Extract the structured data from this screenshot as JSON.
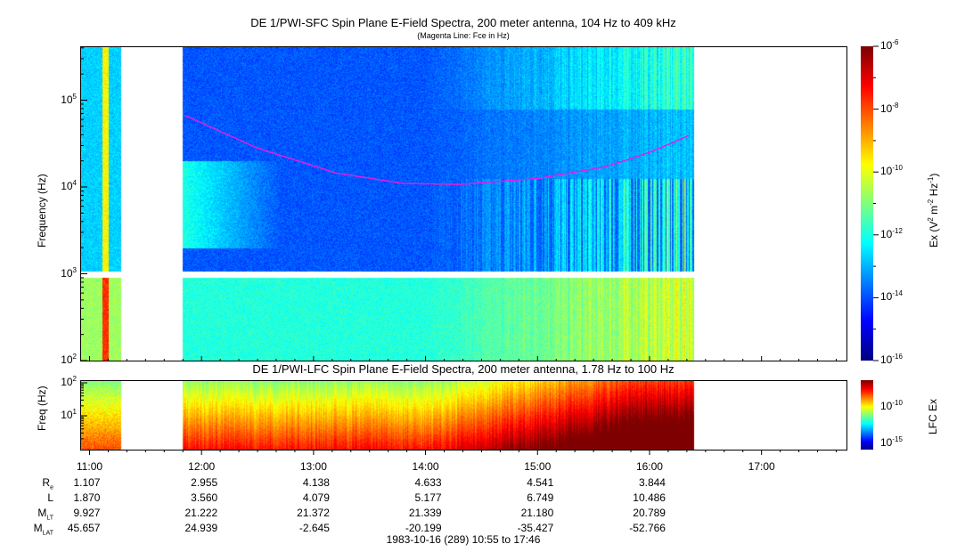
{
  "chart_data": [
    {
      "type": "heatmap",
      "title": "DE 1/PWI-SFC  Spin Plane E-Field Spectra, 200 meter antenna, 104 Hz to 409 kHz",
      "subtitle": "(Magenta Line: Fce in Hz)",
      "ylabel": "Frequency (Hz)",
      "yscale": "log",
      "ylim": [
        100,
        409000
      ],
      "y_ticks": [
        "10^2",
        "10^3",
        "10^4",
        "10^5"
      ],
      "colorbar": {
        "label": "Ex (V^2 m^-2 Hz^-1)",
        "scale": "log",
        "range": [
          1e-16,
          1e-06
        ],
        "ticks": [
          "10^-16",
          "10^-14",
          "10^-12",
          "10^-10",
          "10^-8",
          "10^-6"
        ]
      },
      "data_gaps": [
        [
          "11:17",
          "11:50"
        ]
      ],
      "fce_line": {
        "color": "#e020e0",
        "time_hours": [
          11.85,
          12.5,
          13.2,
          13.8,
          14.3,
          15.0,
          15.6,
          16.0,
          16.35
        ],
        "freq_hz": [
          67000,
          28000,
          14500,
          11000,
          10700,
          12500,
          17000,
          25000,
          39000
        ]
      }
    },
    {
      "type": "heatmap",
      "title": "DE 1/PWI-LFC  Spin Plane E-Field Spectra, 200 meter antenna, 1.78 Hz to 100 Hz",
      "ylabel": "Freq (Hz)",
      "yscale": "log",
      "ylim": [
        1.78,
        100
      ],
      "y_ticks": [
        "10^1",
        "10^2"
      ],
      "colorbar": {
        "label": "LFC Ex",
        "ticks": [
          "10^-15",
          "10^-10"
        ]
      }
    }
  ],
  "x_ticks": [
    "11:00",
    "12:00",
    "13:00",
    "14:00",
    "15:00",
    "16:00",
    "17:00"
  ],
  "ephemeris": {
    "labels": [
      "R",
      "L",
      "M",
      "M"
    ],
    "label_subs": [
      "e",
      "",
      "LT",
      "LAT"
    ],
    "rows": [
      [
        "1.107",
        "2.955",
        "4.138",
        "4.633",
        "4.541",
        "3.844"
      ],
      [
        "1.870",
        "3.560",
        "4.079",
        "5.177",
        "6.749",
        "10.486"
      ],
      [
        "9.927",
        "21.222",
        "21.372",
        "21.339",
        "21.180",
        "20.789"
      ],
      [
        "45.657",
        "24.939",
        "-2.645",
        "-20.199",
        "-35.427",
        "-52.766"
      ]
    ]
  },
  "footer": "1983-10-16 (289) 10:55 to 17:46"
}
